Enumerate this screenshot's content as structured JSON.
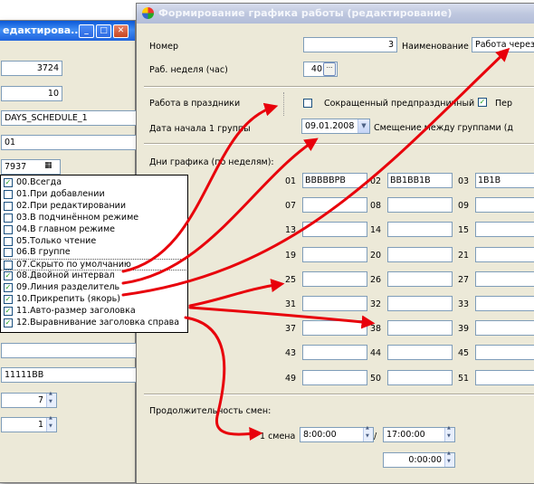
{
  "left_window": {
    "title": "едактирова...",
    "fields": [
      "3724",
      "10",
      "DAYS_SCHEDULE_1",
      "01",
      "7937",
      "",
      "11111BB",
      "7",
      "1"
    ],
    "list": [
      {
        "label": "00.Всегда",
        "checked": true
      },
      {
        "label": "01.При добавлении",
        "checked": false
      },
      {
        "label": "02.При редактировании",
        "checked": false
      },
      {
        "label": "03.В подчинённом режиме",
        "checked": false
      },
      {
        "label": "04.В главном режиме",
        "checked": false
      },
      {
        "label": "05.Только чтение",
        "checked": false
      },
      {
        "label": "06.В группе",
        "checked": false
      },
      {
        "label": "07.Скрыто по умолчанию",
        "checked": false
      },
      {
        "label": "08.Двойной интервал",
        "checked": true
      },
      {
        "label": "09.Линия разделитель",
        "checked": true
      },
      {
        "label": "10.Прикрепить (якорь)",
        "checked": true
      },
      {
        "label": "11.Авто-размер заголовка",
        "checked": true
      },
      {
        "label": "12.Выравнивание заголовка справа",
        "checked": true
      }
    ]
  },
  "main_window": {
    "title": "Формирование графика работы (редактирование)",
    "nomer_label": "Номер",
    "nomer_value": "3",
    "naimenovanie_label": "Наименование",
    "naimenovanie_value": "Работа через",
    "week_label": "Раб. неделя (час)",
    "week_value": "40",
    "holidays_label": "Работа в праздники",
    "shortened_label": "Сокращенный предпраздничный",
    "per_label": "Пер",
    "start_date_label": "Дата начала 1 группы",
    "start_date_value": "09.01.2008",
    "offset_label": "Смещение между группами (д",
    "days_label": "Дни графика (по неделям):",
    "weeks": [
      {
        "n": "01",
        "v": "ВВВВВРВ"
      },
      {
        "n": "02",
        "v": "ВВ1ВВ1В"
      },
      {
        "n": "03",
        "v": "1В1В"
      },
      {
        "n": "07",
        "v": ""
      },
      {
        "n": "08",
        "v": ""
      },
      {
        "n": "09",
        "v": ""
      },
      {
        "n": "13",
        "v": ""
      },
      {
        "n": "14",
        "v": ""
      },
      {
        "n": "15",
        "v": ""
      },
      {
        "n": "19",
        "v": ""
      },
      {
        "n": "20",
        "v": ""
      },
      {
        "n": "21",
        "v": ""
      },
      {
        "n": "25",
        "v": ""
      },
      {
        "n": "26",
        "v": ""
      },
      {
        "n": "27",
        "v": ""
      },
      {
        "n": "31",
        "v": ""
      },
      {
        "n": "32",
        "v": ""
      },
      {
        "n": "33",
        "v": ""
      },
      {
        "n": "37",
        "v": ""
      },
      {
        "n": "38",
        "v": ""
      },
      {
        "n": "39",
        "v": ""
      },
      {
        "n": "43",
        "v": ""
      },
      {
        "n": "44",
        "v": ""
      },
      {
        "n": "45",
        "v": ""
      },
      {
        "n": "49",
        "v": ""
      },
      {
        "n": "50",
        "v": ""
      },
      {
        "n": "51",
        "v": ""
      }
    ],
    "shift_duration_label": "Продолжительность смен:",
    "shift1_label": "1 смена",
    "shift1_from": "8:00:00",
    "slash": "/",
    "shift1_to": "17:00:00",
    "shift2_to": "0:00:00"
  },
  "colors": {
    "arrow": "#e8000b",
    "title_active": "#0a58d8",
    "window_bg": "#ece9d8"
  }
}
